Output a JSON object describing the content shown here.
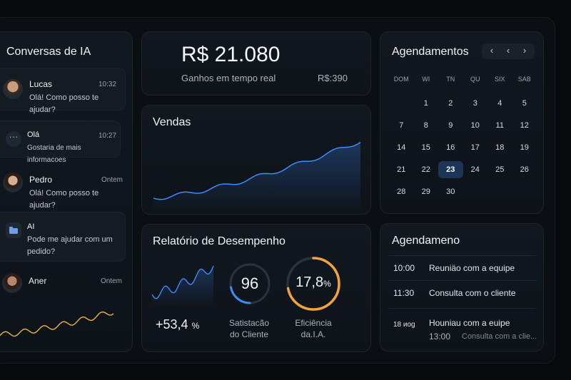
{
  "chats": {
    "title": "Conversas de IA",
    "items": [
      {
        "name": "Lucas",
        "time": "10:32",
        "message": "Olá! Como posso te ajudar?"
      },
      {
        "name": "Olá",
        "time": "10:27",
        "message": "Gostaria de mais informacoes"
      },
      {
        "name": "Pedro",
        "time": "Ontem",
        "message": "Olá! Como posso te ajudar?"
      },
      {
        "name": "AI",
        "time": "",
        "message": "Pode me ajudar com um pedido?"
      },
      {
        "name": "Aner",
        "time": "Ontem",
        "message": ""
      }
    ]
  },
  "earnings": {
    "value": "R$ 21.080",
    "label": "Ganhos em tempo real",
    "sub_value": "R$:390"
  },
  "sales": {
    "title": "Vendas",
    "line_color": "#3d8bfd"
  },
  "performance": {
    "title": "Relatório de Desempenho",
    "growth_value": "+53,4",
    "growth_unit": "%",
    "satisfaction_value": "96",
    "satisfaction_label_1": "Satistacão",
    "satisfaction_label_2": "do Cliente",
    "satisfaction_level": 0.22,
    "efficiency_value": "17,8",
    "efficiency_unit": "%",
    "efficiency_label_1": "Eficiência",
    "efficiency_label_2": "da.I.A.",
    "efficiency_level": 0.72,
    "blue": "#3d8bfd",
    "orange": "#f2a33a"
  },
  "calendar": {
    "title": "Agendamentos",
    "nav": [
      "‹",
      "‹",
      "›"
    ],
    "weekdays": [
      "DOM",
      "WI",
      "TN",
      "QU",
      "SIX",
      "SAB"
    ],
    "weeks": [
      [
        "",
        "1",
        "2",
        "3",
        "4",
        "5"
      ],
      [
        "7",
        "8",
        "9",
        "10",
        "11",
        "12"
      ],
      [
        "14",
        "15",
        "16",
        "17",
        "18",
        "19"
      ],
      [
        "21",
        "22",
        "23",
        "24",
        "25",
        "26"
      ],
      [
        "28",
        "29",
        "30",
        "",
        "",
        ""
      ]
    ],
    "selected": "23",
    "accent": "#1d3557"
  },
  "agenda": {
    "title": "Agendameno",
    "items": [
      {
        "time": "10:00",
        "desc": "Reuniäo com a equipe"
      },
      {
        "time": "11:30",
        "desc": "Consulta com o cliente"
      }
    ],
    "last_time": "18 иog",
    "last_desc": "Houniau com a euipe",
    "last_sub_time": "13:00",
    "last_sub_desc": "Consulta com a clie..."
  }
}
